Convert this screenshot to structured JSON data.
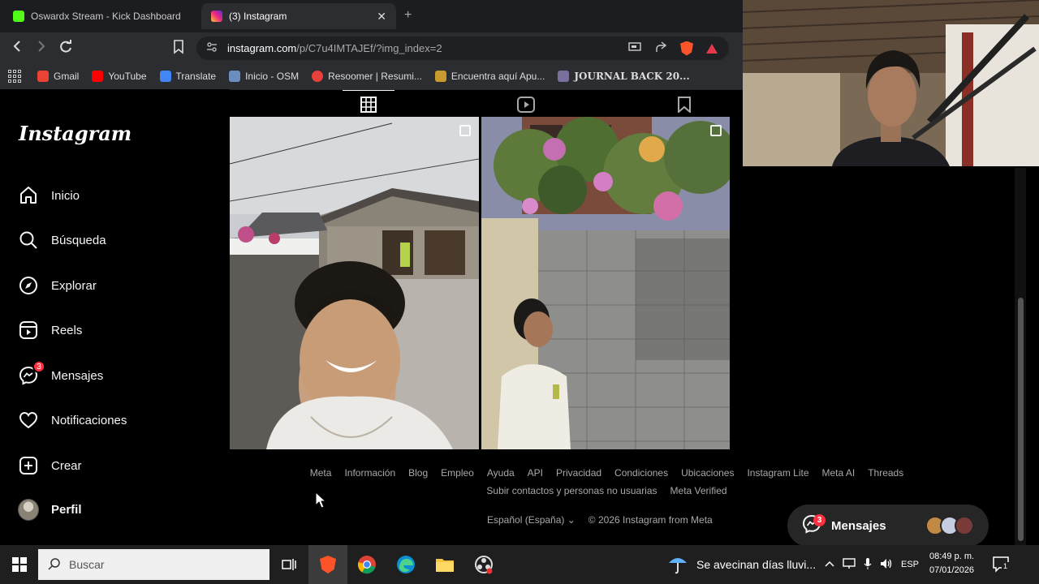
{
  "browser": {
    "tabs": [
      {
        "title": "Oswardx Stream - Kick Dashboard",
        "active": false
      },
      {
        "title": "(3) Instagram",
        "active": true
      }
    ],
    "new_tab": "+",
    "close_glyph": "✕",
    "url_host": "instagram.com",
    "url_path": "/p/C7u4IMTAJEf/?img_index=2",
    "bookmarks": [
      "Gmail",
      "YouTube",
      "Translate",
      "Inicio - OSM",
      "Resoomer | Resumi...",
      "Encuentra aquí Apu...",
      "JOURNAL BACK 20..."
    ],
    "bookmark_colors": [
      "#ea4335",
      "#ff0000",
      "#4285f4",
      "#6c8ebf",
      "#e8413b",
      "#c99a2e",
      "#7b6f9e"
    ]
  },
  "instagram": {
    "logo": "Instagram",
    "nav": [
      {
        "label": "Inicio",
        "icon": "home-icon"
      },
      {
        "label": "Búsqueda",
        "icon": "search-icon"
      },
      {
        "label": "Explorar",
        "icon": "compass-icon"
      },
      {
        "label": "Reels",
        "icon": "reels-icon"
      },
      {
        "label": "Mensajes",
        "icon": "messenger-icon",
        "badge": "3"
      },
      {
        "label": "Notificaciones",
        "icon": "heart-icon"
      },
      {
        "label": "Crear",
        "icon": "plus-square-icon"
      },
      {
        "label": "Perfil",
        "icon": "avatar"
      }
    ],
    "profile_tabs": [
      "posts-grid-icon",
      "reels-tab-icon",
      "saved-icon"
    ],
    "footer_links": [
      "Meta",
      "Información",
      "Blog",
      "Empleo",
      "Ayuda",
      "API",
      "Privacidad",
      "Condiciones",
      "Ubicaciones",
      "Instagram Lite",
      "Meta AI",
      "Threads",
      "Subir contactos y personas no usuarias",
      "Meta Verified"
    ],
    "language": "Español (España)",
    "copyright": "© 2026 Instagram from Meta",
    "messages_pill": {
      "label": "Mensajes",
      "badge": "3"
    }
  },
  "taskbar": {
    "search_placeholder": "Buscar",
    "weather": "Se avecinan días lluvi...",
    "lang": "ESP",
    "time": "08:49 p. m.",
    "date": "07/01/2026",
    "notif_count": "1"
  },
  "colors": {
    "accent_badge": "#ff3040",
    "bg": "#000000",
    "text": "#f5f5f5",
    "muted": "#a8a8a8"
  }
}
